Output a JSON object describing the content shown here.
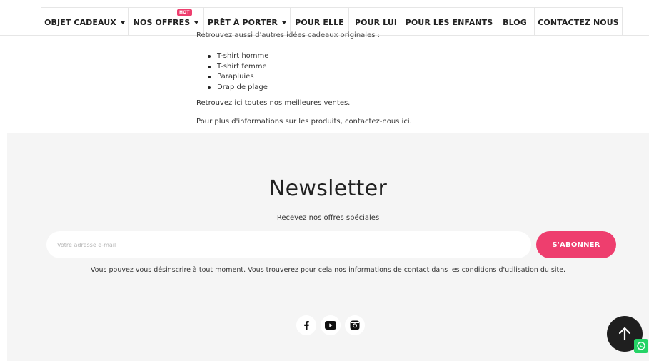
{
  "nav": {
    "items": [
      {
        "label": "OBJET CADEAUX",
        "dropdown": true
      },
      {
        "label": "NOS OFFRES",
        "dropdown": true,
        "badge": "HOT"
      },
      {
        "label": "PRÊT À PORTER",
        "dropdown": true
      },
      {
        "label": "POUR ELLE",
        "dropdown": false
      },
      {
        "label": "POUR LUI",
        "dropdown": false
      },
      {
        "label": "POUR LES ENFANTS",
        "dropdown": false
      },
      {
        "label": "BLOG",
        "dropdown": false
      },
      {
        "label": "CONTACTEZ NOUS",
        "dropdown": false
      }
    ]
  },
  "content": {
    "cut_line": "Retrouvez aussi d'autres idées cadeaux originales :",
    "bullets": [
      "T-shirt homme",
      "T-shirt femme",
      "Parapluies",
      "Drap de plage"
    ],
    "paragraph1": "Retrouvez ici toutes nos meilleures ventes.",
    "paragraph2": "Pour plus d'informations sur les produits, contactez-nous ici."
  },
  "newsletter": {
    "title": "Newsletter",
    "subtitle": "Recevez nos offres spéciales",
    "email_placeholder": "Votre adresse e-mail",
    "subscribe_label": "S'ABONNER",
    "note": "Vous pouvez vous désinscrire à tout moment. Vous trouverez pour cela nos informations de contact dans les conditions d'utilisation du site."
  },
  "socials": [
    "facebook-icon",
    "youtube-icon",
    "instagram-icon"
  ],
  "colors": {
    "accent": "#ee3e6e",
    "newsletter_bg": "#f5f5f5",
    "scroll_button": "#1f1f1f",
    "whatsapp": "#25d366"
  }
}
